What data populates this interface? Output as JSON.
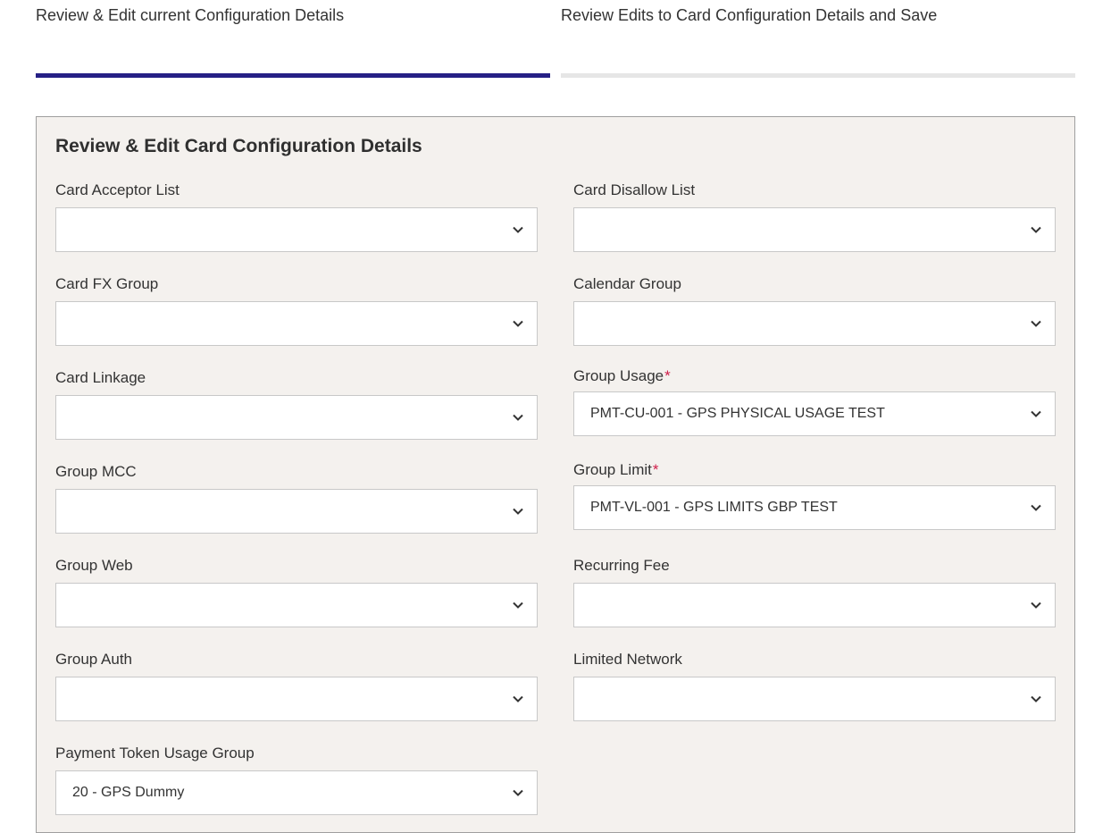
{
  "steps": [
    {
      "label": "Review & Edit current Configuration Details",
      "active": true
    },
    {
      "label": "Review Edits to Card Configuration Details and Save",
      "active": false
    }
  ],
  "panel": {
    "title": "Review & Edit Card Configuration Details",
    "required_marker": "*",
    "fields": {
      "card_acceptor_list": {
        "label": "Card Acceptor List",
        "value": ""
      },
      "card_disallow_list": {
        "label": "Card Disallow List",
        "value": ""
      },
      "card_fx_group": {
        "label": "Card FX Group",
        "value": ""
      },
      "calendar_group": {
        "label": "Calendar Group",
        "value": ""
      },
      "card_linkage": {
        "label": "Card Linkage",
        "value": ""
      },
      "group_usage": {
        "label": "Group Usage",
        "required": true,
        "value": "PMT-CU-001 - GPS PHYSICAL USAGE TEST"
      },
      "group_mcc": {
        "label": "Group MCC",
        "value": ""
      },
      "group_limit": {
        "label": "Group Limit",
        "required": true,
        "value": "PMT-VL-001 - GPS LIMITS GBP TEST"
      },
      "group_web": {
        "label": "Group Web",
        "value": ""
      },
      "recurring_fee": {
        "label": "Recurring Fee",
        "value": ""
      },
      "group_auth": {
        "label": "Group Auth",
        "value": ""
      },
      "limited_network": {
        "label": "Limited Network",
        "value": ""
      },
      "payment_token_usage_group": {
        "label": "Payment Token Usage Group",
        "value": "20 - GPS Dummy"
      }
    }
  },
  "icons": {
    "dropdown": "chevron-down-icon"
  },
  "colors": {
    "active_step": "#262085",
    "inactive_step": "#e6e6e6",
    "panel_bg": "#f4f1ee",
    "required": "#cf1e4a"
  }
}
